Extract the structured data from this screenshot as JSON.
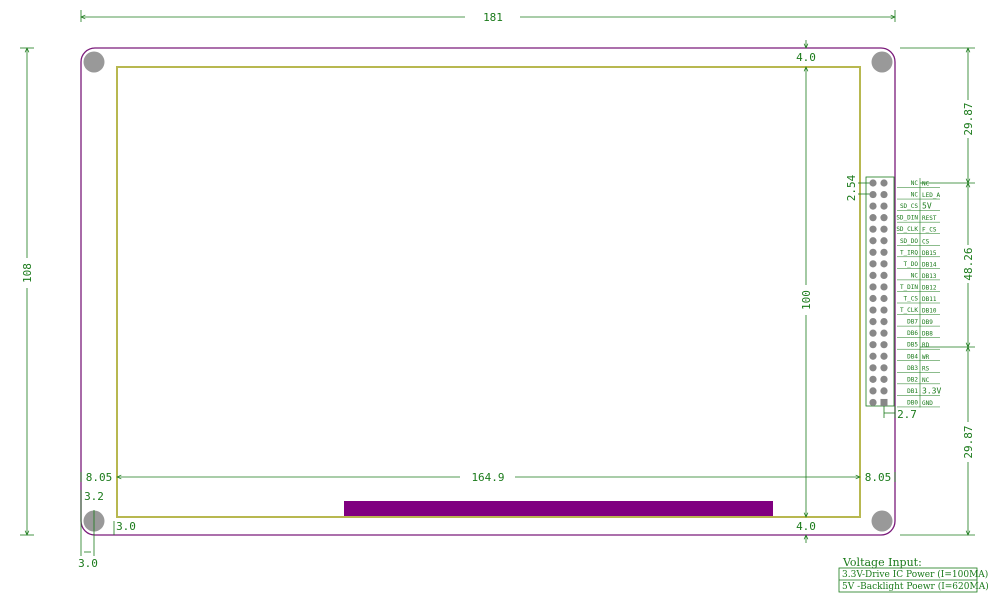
{
  "colors": {
    "dimension": "#1a7a1a",
    "board_outline": "#7a1a7a",
    "active_area": "#b8b850",
    "fpc_bar": "#800080",
    "mounting_hole": "#999999",
    "pin": "#888888"
  },
  "dimensions": {
    "overall_width": "181",
    "overall_height": "108",
    "active_width": "164.9",
    "active_height": "100",
    "top_margin": "4.0",
    "bottom_margin": "4.0",
    "left_margin": "8.05",
    "right_margin": "8.05",
    "right_top": "29.87",
    "right_mid": "48.26",
    "right_bottom": "29.87",
    "pin_pitch": "2.54",
    "header_offset": "2.7",
    "hole_offset_y": "3.2",
    "hole_offset_x": "3.0",
    "hole_offset_bottom": "3.0"
  },
  "header": {
    "left_labels": [
      "NC",
      "NC",
      "SD_CS",
      "SD_DIN",
      "SD_CLK",
      "SD_DO",
      "T_IRQ",
      "T_DO",
      "NC",
      "T_DIN",
      "T_CS",
      "T_CLK",
      "DB7",
      "DB6",
      "DB5",
      "DB4",
      "DB3",
      "DB2",
      "DB1",
      "DB0"
    ],
    "right_labels": [
      "NC",
      "LED_A",
      "5V",
      "REST",
      "F_CS",
      "CS",
      "DB15",
      "DB14",
      "DB13",
      "DB12",
      "DB11",
      "DB10",
      "DB9",
      "DB8",
      "RD",
      "WR",
      "RS",
      "NC",
      "3.3V",
      "GND"
    ]
  },
  "voltage_note": {
    "title": "Voltage Input:",
    "line1": "3.3V-Drive IC Power (I=100MA)",
    "line2": "5V  -Backlight Poewr (I=620MA)"
  }
}
